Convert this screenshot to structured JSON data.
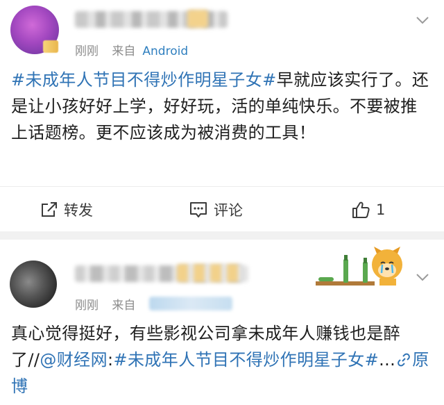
{
  "post1": {
    "time": "刚刚",
    "source_prefix": "来自",
    "source": "Android",
    "topic": "#未成年人节目不得炒作明星子女#",
    "text": "早就应该实行了。还是让小孩好好上学，好好玩，活的单纯快乐。不要被推上话题榜。更不应该成为被消费的工具！",
    "actions": {
      "repost_label": "转发",
      "comment_label": "评论",
      "like_count": "1"
    }
  },
  "post2": {
    "time": "刚刚",
    "source_prefix": "来自",
    "text": "真心觉得挺好，有些影视公司拿未成年人赚钱也是醉了//",
    "mention": "@财经网",
    "colon": ":",
    "topic": "#未成年人节目不得炒作明星子女#",
    "ellipsis": "...",
    "link_label": "原博"
  },
  "colors": {
    "link_blue": "#2f73b5",
    "meta_gray": "#8c8c8c",
    "separator": "#f1f1f1"
  },
  "icons": [
    "chevron-down-icon",
    "repost-icon",
    "comment-icon",
    "like-icon",
    "link-icon"
  ]
}
